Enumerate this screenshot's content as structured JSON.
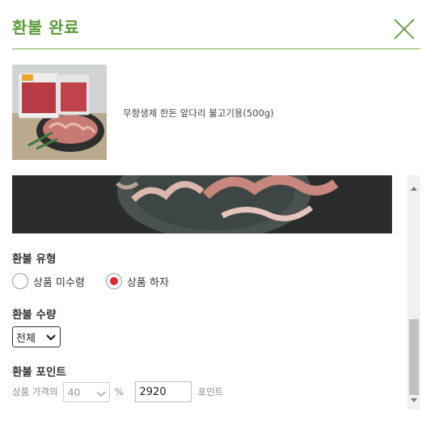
{
  "header": {
    "title": "환불 완료"
  },
  "product": {
    "name": "무항생제 한돈 앞다리 불고기용(500g)"
  },
  "refund_type": {
    "label": "환불 유형",
    "options": [
      {
        "label": "상품 미수령",
        "checked": false
      },
      {
        "label": "상품 하자",
        "checked": true
      }
    ]
  },
  "refund_qty": {
    "label": "환불 수량",
    "selected": "전체"
  },
  "refund_point": {
    "label": "환불 포인트",
    "price_label": "상품 가격의",
    "percent_value": "40",
    "percent_suffix": "%",
    "point_value": "2920",
    "point_unit": "포인트"
  },
  "colors": {
    "accent_green": "#5a9a3a",
    "radio_checked": "#e02a2a"
  }
}
